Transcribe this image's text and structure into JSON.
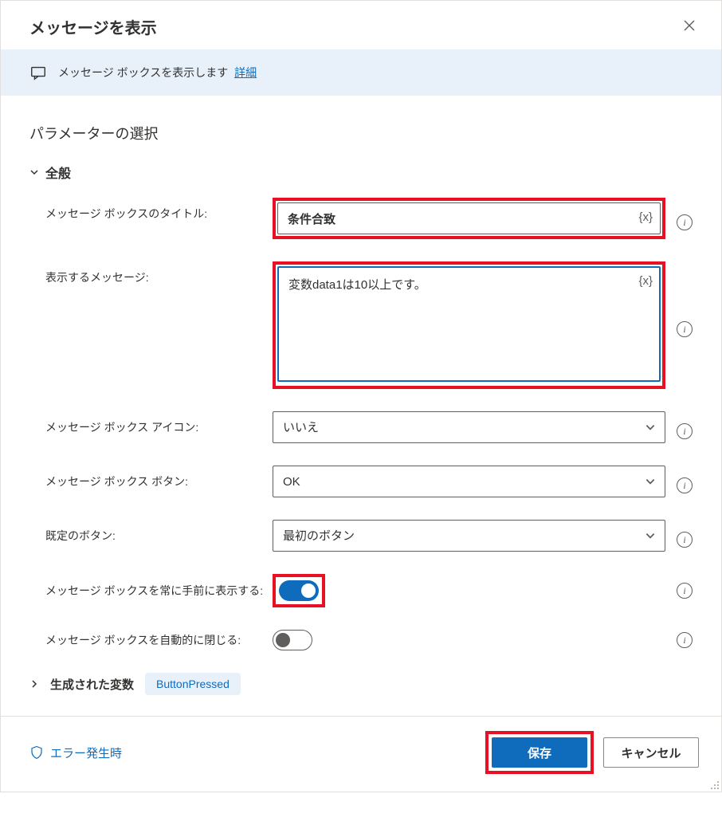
{
  "dialog": {
    "title": "メッセージを表示",
    "banner_text": "メッセージ ボックスを表示します",
    "banner_link": "詳細",
    "section_title": "パラメーターの選択",
    "group_general": "全般",
    "labels": {
      "title": "メッセージ ボックスのタイトル:",
      "message": "表示するメッセージ:",
      "icon": "メッセージ ボックス アイコン:",
      "buttons": "メッセージ ボックス ボタン:",
      "default_button": "既定のボタン:",
      "topmost": "メッセージ ボックスを常に手前に表示する:",
      "autoclose": "メッセージ ボックスを自動的に閉じる:"
    },
    "values": {
      "title": "条件合致",
      "message": "変数data1は10以上です。",
      "icon": "いいえ",
      "buttons": "OK",
      "default_button": "最初のボタン"
    },
    "var_token": "{x}",
    "generated_vars_label": "生成された変数",
    "generated_var": "ButtonPressed",
    "error_link": "エラー発生時",
    "save": "保存",
    "cancel": "キャンセル"
  }
}
